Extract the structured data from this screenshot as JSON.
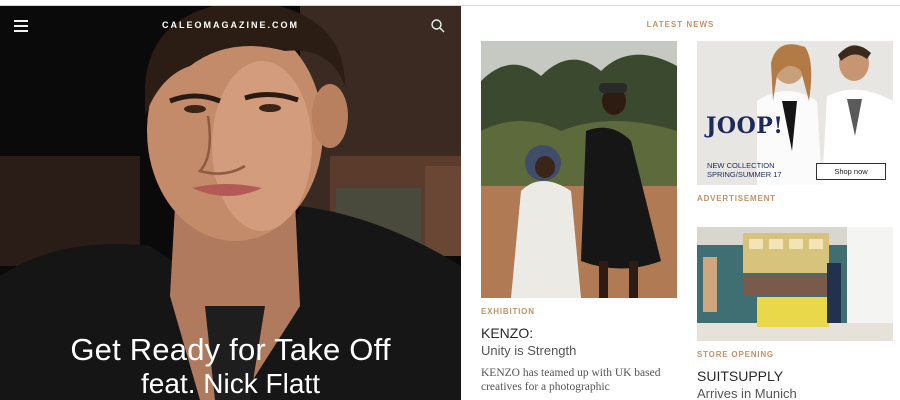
{
  "site": {
    "brand": "CALEOMAGAZINE.COM"
  },
  "hero": {
    "title_line1": "Get Ready for Take Off",
    "title_line2": "feat. Nick Flatt"
  },
  "latest": {
    "heading": "LATEST NEWS"
  },
  "articles": [
    {
      "tag": "EXHIBITION",
      "title": "KENZO:",
      "subtitle": "Unity is Strength",
      "excerpt_line1": "KENZO has teamed up with UK based",
      "excerpt_line2": "creatives for a photographic"
    },
    {
      "tag": "STORE OPENING",
      "title": "SUITSUPPLY",
      "subtitle": "Arrives in Munich"
    }
  ],
  "ad": {
    "label": "ADVERTISEMENT",
    "logo": "JOOP!",
    "copy_line1": "NEW COLLECTION",
    "copy_line2": "SPRING/SUMMER 17",
    "cta": "Shop now"
  },
  "colors": {
    "accent": "#c0946a",
    "ad_navy": "#1d2a5c",
    "hero_bg": "#0b0b0b"
  },
  "icons": {
    "menu": "hamburger-menu-icon",
    "search": "search-icon"
  }
}
